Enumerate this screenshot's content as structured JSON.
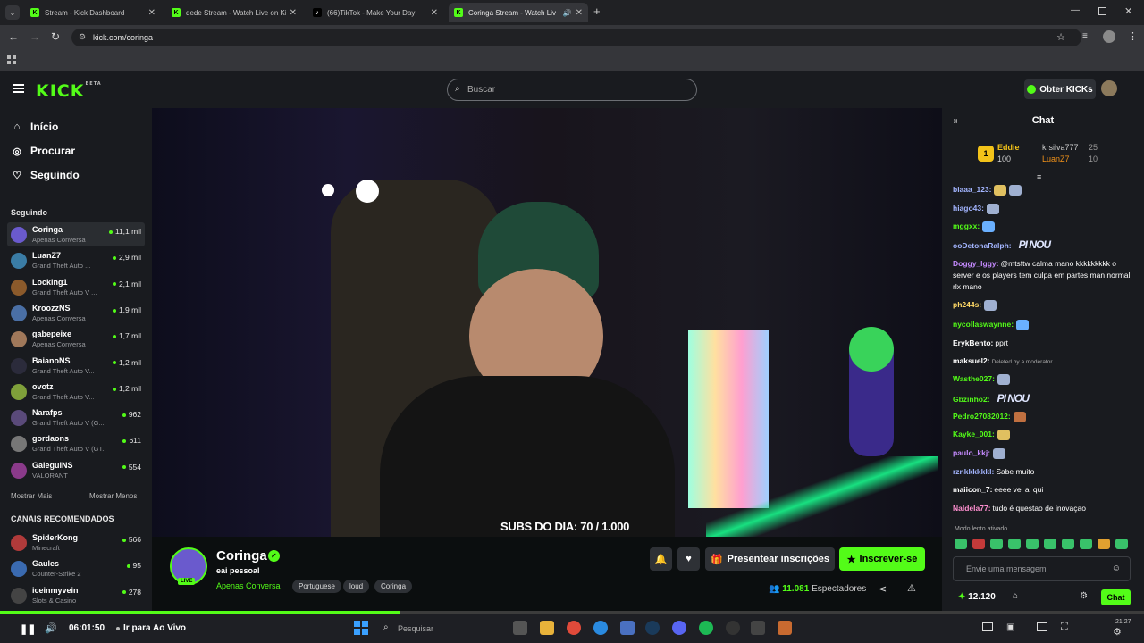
{
  "browser": {
    "tabs": [
      {
        "title": "Stream - Kick Dashboard",
        "icon": "kick-icon"
      },
      {
        "title": "dede Stream - Watch Live on Ki",
        "icon": "kick-icon"
      },
      {
        "title": "(66)TikTok - Make Your Day",
        "icon": "tiktok-icon"
      },
      {
        "title": "Coringa Stream - Watch Liv",
        "icon": "kick-icon"
      }
    ],
    "url": "kick.com/coringa"
  },
  "header": {
    "logo": "KICK",
    "beta": "BETA",
    "search_placeholder": "Buscar",
    "kicks_button": "Obter KICKs"
  },
  "sidebar": {
    "nav": [
      {
        "label": "Início",
        "icon": "home-icon"
      },
      {
        "label": "Procurar",
        "icon": "compass-icon"
      },
      {
        "label": "Seguindo",
        "icon": "heart-icon"
      }
    ],
    "following_heading": "Seguindo",
    "following": [
      {
        "name": "Coringa",
        "game": "Apenas Conversa",
        "viewers": "11,1 mil",
        "color": "#6a5acd"
      },
      {
        "name": "LuanZ7",
        "game": "Grand Theft Auto ...",
        "viewers": "2,9 mil",
        "color": "#3a7ca5"
      },
      {
        "name": "Locking1",
        "game": "Grand Theft Auto V ...",
        "viewers": "2,1 mil",
        "color": "#8b5a2b"
      },
      {
        "name": "KroozzNS",
        "game": "Apenas Conversa",
        "viewers": "1,9 mil",
        "color": "#4a6fa5"
      },
      {
        "name": "gabepeixe",
        "game": "Apenas Conversa",
        "viewers": "1,7 mil",
        "color": "#a0785a"
      },
      {
        "name": "BaianoNS",
        "game": "Grand Theft Auto V...",
        "viewers": "1,2 mil",
        "color": "#2b2b3b"
      },
      {
        "name": "ovotz",
        "game": "Grand Theft Auto V...",
        "viewers": "1,2 mil",
        "color": "#7fa03a"
      },
      {
        "name": "Narafps",
        "game": "Grand Theft Auto V (G...",
        "viewers": "962",
        "color": "#5a4a7a"
      },
      {
        "name": "gordaons",
        "game": "Grand Theft Auto V (GT...",
        "viewers": "611",
        "color": "#777777"
      },
      {
        "name": "GaleguiNS",
        "game": "VALORANT",
        "viewers": "554",
        "color": "#8a3a8a"
      }
    ],
    "show_more": "Mostrar Mais",
    "show_less": "Mostrar Menos",
    "recommended_heading": "CANAIS RECOMENDADOS",
    "recommended": [
      {
        "name": "SpiderKong",
        "game": "Minecraft",
        "viewers": "566",
        "color": "#b03a3a"
      },
      {
        "name": "Gaules",
        "game": "Counter-Strike 2",
        "viewers": "95",
        "color": "#3a6ab0"
      },
      {
        "name": "iceinmyvein",
        "game": "Slots & Casino",
        "viewers": "278",
        "color": "#444444"
      }
    ]
  },
  "video": {
    "overlay": "SUBS DO DIA: 70 / 1.000"
  },
  "stream": {
    "streamer": "Coringa",
    "title": "eai pessoal",
    "category": "Apenas Conversa",
    "live_badge": "LIVE",
    "tags": [
      "Portuguese",
      "loud",
      "Coringa"
    ],
    "gift_button": "Presentear inscrições",
    "subscribe_button": "Inscrever-se",
    "viewers": "11.081",
    "viewers_label": "Espectadores"
  },
  "chat": {
    "title": "Chat",
    "leaderboard": [
      {
        "name": "Eddie",
        "value": "100"
      },
      {
        "name": "krsilva777",
        "value": "25"
      },
      {
        "name": "LuanZ7",
        "value": "10"
      }
    ],
    "messages": [
      {
        "user": "biaaa_123:",
        "text": "",
        "color": "#a3b5ff",
        "emotes": 2
      },
      {
        "user": "hiago43:",
        "text": "",
        "color": "#a3b5ff",
        "emotes": 1
      },
      {
        "user": "mggxx:",
        "text": "",
        "color": "#53fc18",
        "emotes": 1
      },
      {
        "user": "ooDetonaRalph:",
        "text": "PI NOU",
        "color": "#a3b5ff",
        "emotes": 0
      },
      {
        "user": "Doggy_lggy:",
        "text": "@mtsftw calma mano kkkkkkkkk o server e os players tem culpa em partes man normal rlx mano",
        "color": "#c58aff",
        "emotes": 0
      },
      {
        "user": "ph244s:",
        "text": "",
        "color": "#ffd966",
        "emotes": 1
      },
      {
        "user": "nycollaswaynne:",
        "text": "",
        "color": "#53fc18",
        "emotes": 1
      },
      {
        "user": "ErykBento:",
        "text": "pprt",
        "color": "#ffffff",
        "emotes": 0
      },
      {
        "user": "maksuel2:",
        "text": "Deleted by a moderator",
        "color": "#ffffff",
        "emotes": 0
      },
      {
        "user": "Wasthe027:",
        "text": "",
        "color": "#53fc18",
        "emotes": 1
      },
      {
        "user": "Gbzinho2:",
        "text": "PI NOU",
        "color": "#53fc18",
        "emotes": 0
      },
      {
        "user": "Pedro27082012:",
        "text": "",
        "color": "#53fc18",
        "emotes": 1
      },
      {
        "user": "Kayke_001:",
        "text": "",
        "color": "#53fc18",
        "emotes": 1
      },
      {
        "user": "paulo_kkj:",
        "text": "",
        "color": "#c58aff",
        "emotes": 1
      },
      {
        "user": "rznkkkkkkl:",
        "text": "Sabe muito",
        "color": "#a3b5ff",
        "emotes": 0
      },
      {
        "user": "maiicon_7:",
        "text": "eeee vei ai qui",
        "color": "#ffffff",
        "emotes": 0
      },
      {
        "user": "Naldela77:",
        "text": "tudo é questao de inovaçao",
        "color": "#ff8fd0",
        "emotes": 0
      }
    ],
    "slow_mode": "Modo lento ativado",
    "input_placeholder": "Envie uma mensagem",
    "points": "12.120",
    "send_button": "Chat"
  },
  "player": {
    "time": "06:01:50",
    "go_live": "Ir para Ao Vivo",
    "progress": 0.35
  },
  "taskbar": {
    "search_placeholder": "Pesquisar",
    "clock": "21:27"
  },
  "colors": {
    "accent": "#53fc18",
    "background": "#0b0e0f",
    "panel": "#191b1f"
  }
}
